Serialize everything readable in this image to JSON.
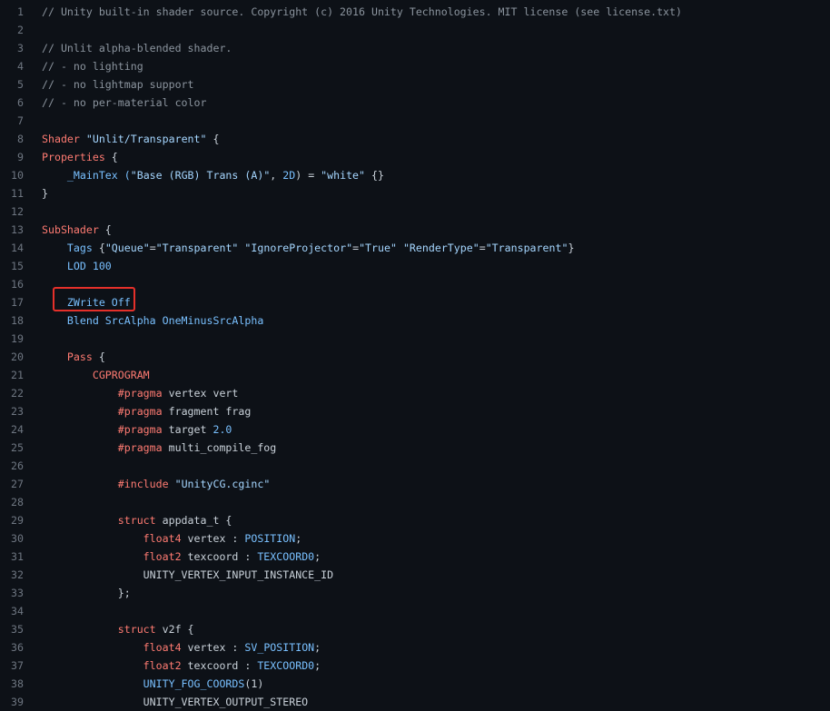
{
  "highlight": {
    "label": "ZWrite Off",
    "line": 17,
    "color": "#e5302a"
  },
  "colors": {
    "background": "#0d1117",
    "comment": "#8b949e",
    "keyword": "#ff7b72",
    "string": "#a5d6ff",
    "constant": "#79c0ff",
    "text": "#c9d1d9",
    "line_number": "#6e7681"
  },
  "lines": [
    {
      "n": "1",
      "tokens": [
        {
          "t": "// Unity built-in shader source. Copyright (c) 2016 Unity Technologies. MIT license (see license.txt)",
          "c": "cm"
        }
      ]
    },
    {
      "n": "2",
      "tokens": []
    },
    {
      "n": "3",
      "tokens": [
        {
          "t": "// Unlit alpha-blended shader.",
          "c": "cm"
        }
      ]
    },
    {
      "n": "4",
      "tokens": [
        {
          "t": "// - no lighting",
          "c": "cm"
        }
      ]
    },
    {
      "n": "5",
      "tokens": [
        {
          "t": "// - no lightmap support",
          "c": "cm"
        }
      ]
    },
    {
      "n": "6",
      "tokens": [
        {
          "t": "// - no per-material color",
          "c": "cm"
        }
      ]
    },
    {
      "n": "7",
      "tokens": []
    },
    {
      "n": "8",
      "tokens": [
        {
          "t": "Shader ",
          "c": "kw"
        },
        {
          "t": "\"Unlit/Transparent\"",
          "c": "st"
        },
        {
          "t": " {",
          "c": "pl"
        }
      ]
    },
    {
      "n": "9",
      "tokens": [
        {
          "t": "Properties",
          "c": "kw"
        },
        {
          "t": " {",
          "c": "pl"
        }
      ]
    },
    {
      "n": "10",
      "tokens": [
        {
          "t": "    _MainTex (",
          "c": "bl"
        },
        {
          "t": "\"Base (RGB) Trans (A)\"",
          "c": "st"
        },
        {
          "t": ", ",
          "c": "pl"
        },
        {
          "t": "2D",
          "c": "bl"
        },
        {
          "t": ") = ",
          "c": "pl"
        },
        {
          "t": "\"white\"",
          "c": "st"
        },
        {
          "t": " {}",
          "c": "pl"
        }
      ]
    },
    {
      "n": "11",
      "tokens": [
        {
          "t": "}",
          "c": "pl"
        }
      ]
    },
    {
      "n": "12",
      "tokens": []
    },
    {
      "n": "13",
      "tokens": [
        {
          "t": "SubShader",
          "c": "kw"
        },
        {
          "t": " {",
          "c": "pl"
        }
      ]
    },
    {
      "n": "14",
      "tokens": [
        {
          "t": "    Tags",
          "c": "bl"
        },
        {
          "t": " {",
          "c": "pl"
        },
        {
          "t": "\"Queue\"",
          "c": "st"
        },
        {
          "t": "=",
          "c": "pl"
        },
        {
          "t": "\"Transparent\"",
          "c": "st"
        },
        {
          "t": " ",
          "c": "pl"
        },
        {
          "t": "\"IgnoreProjector\"",
          "c": "st"
        },
        {
          "t": "=",
          "c": "pl"
        },
        {
          "t": "\"True\"",
          "c": "st"
        },
        {
          "t": " ",
          "c": "pl"
        },
        {
          "t": "\"RenderType\"",
          "c": "st"
        },
        {
          "t": "=",
          "c": "pl"
        },
        {
          "t": "\"Transparent\"",
          "c": "st"
        },
        {
          "t": "}",
          "c": "pl"
        }
      ]
    },
    {
      "n": "15",
      "tokens": [
        {
          "t": "    LOD 100",
          "c": "bl"
        }
      ]
    },
    {
      "n": "16",
      "tokens": []
    },
    {
      "n": "17",
      "tokens": [
        {
          "t": "    ZWrite Off",
          "c": "bl"
        }
      ]
    },
    {
      "n": "18",
      "tokens": [
        {
          "t": "    Blend SrcAlpha OneMinusSrcAlpha",
          "c": "bl"
        }
      ]
    },
    {
      "n": "19",
      "tokens": []
    },
    {
      "n": "20",
      "tokens": [
        {
          "t": "    Pass",
          "c": "kw"
        },
        {
          "t": " {",
          "c": "pl"
        }
      ]
    },
    {
      "n": "21",
      "tokens": [
        {
          "t": "        CGPROGRAM",
          "c": "kw"
        }
      ]
    },
    {
      "n": "22",
      "tokens": [
        {
          "t": "            #pragma",
          "c": "kw"
        },
        {
          "t": " vertex vert",
          "c": "pl"
        }
      ]
    },
    {
      "n": "23",
      "tokens": [
        {
          "t": "            #pragma",
          "c": "kw"
        },
        {
          "t": " fragment frag",
          "c": "pl"
        }
      ]
    },
    {
      "n": "24",
      "tokens": [
        {
          "t": "            #pragma",
          "c": "kw"
        },
        {
          "t": " target ",
          "c": "pl"
        },
        {
          "t": "2.0",
          "c": "bl"
        }
      ]
    },
    {
      "n": "25",
      "tokens": [
        {
          "t": "            #pragma",
          "c": "kw"
        },
        {
          "t": " multi_compile_fog",
          "c": "pl"
        }
      ]
    },
    {
      "n": "26",
      "tokens": []
    },
    {
      "n": "27",
      "tokens": [
        {
          "t": "            #include",
          "c": "kw"
        },
        {
          "t": " ",
          "c": "pl"
        },
        {
          "t": "\"UnityCG.cginc\"",
          "c": "st"
        }
      ]
    },
    {
      "n": "28",
      "tokens": []
    },
    {
      "n": "29",
      "tokens": [
        {
          "t": "            struct",
          "c": "kw"
        },
        {
          "t": " appdata_t {",
          "c": "pl"
        }
      ]
    },
    {
      "n": "30",
      "tokens": [
        {
          "t": "                float4",
          "c": "kw"
        },
        {
          "t": " vertex : ",
          "c": "pl"
        },
        {
          "t": "POSITION",
          "c": "bl"
        },
        {
          "t": ";",
          "c": "pl"
        }
      ]
    },
    {
      "n": "31",
      "tokens": [
        {
          "t": "                float2",
          "c": "kw"
        },
        {
          "t": " texcoord : ",
          "c": "pl"
        },
        {
          "t": "TEXCOORD0",
          "c": "bl"
        },
        {
          "t": ";",
          "c": "pl"
        }
      ]
    },
    {
      "n": "32",
      "tokens": [
        {
          "t": "                UNITY_VERTEX_INPUT_INSTANCE_ID",
          "c": "pl"
        }
      ]
    },
    {
      "n": "33",
      "tokens": [
        {
          "t": "            };",
          "c": "pl"
        }
      ]
    },
    {
      "n": "34",
      "tokens": []
    },
    {
      "n": "35",
      "tokens": [
        {
          "t": "            struct",
          "c": "kw"
        },
        {
          "t": " v2f {",
          "c": "pl"
        }
      ]
    },
    {
      "n": "36",
      "tokens": [
        {
          "t": "                float4",
          "c": "kw"
        },
        {
          "t": " vertex : ",
          "c": "pl"
        },
        {
          "t": "SV_POSITION",
          "c": "bl"
        },
        {
          "t": ";",
          "c": "pl"
        }
      ]
    },
    {
      "n": "37",
      "tokens": [
        {
          "t": "                float2",
          "c": "kw"
        },
        {
          "t": " texcoord : ",
          "c": "pl"
        },
        {
          "t": "TEXCOORD0",
          "c": "bl"
        },
        {
          "t": ";",
          "c": "pl"
        }
      ]
    },
    {
      "n": "38",
      "tokens": [
        {
          "t": "                UNITY_FOG_COORDS",
          "c": "bl"
        },
        {
          "t": "(1)",
          "c": "pl"
        }
      ]
    },
    {
      "n": "39",
      "tokens": [
        {
          "t": "                UNITY_VERTEX_OUTPUT_STEREO",
          "c": "pl"
        }
      ]
    }
  ]
}
